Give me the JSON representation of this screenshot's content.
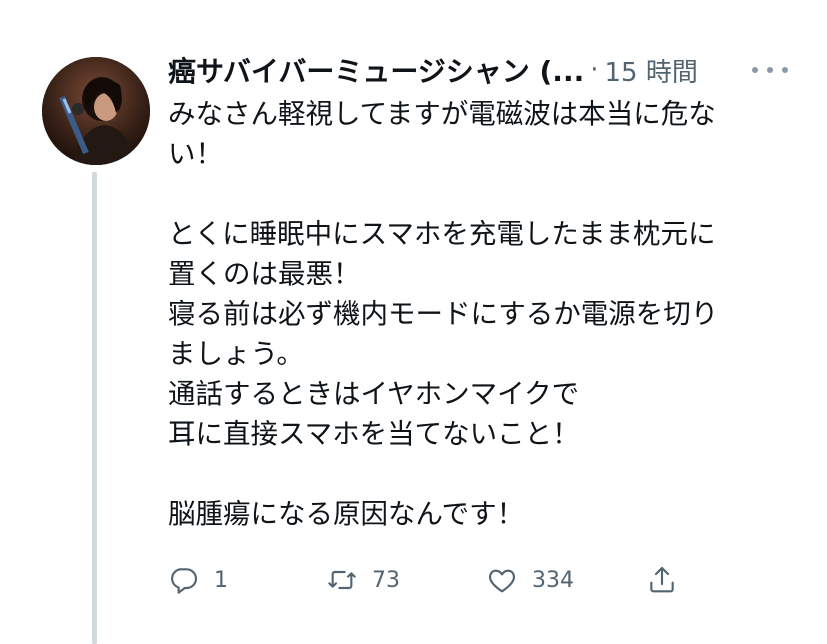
{
  "tweet": {
    "author_name": "癌サバイバーミュージシャン (...",
    "separator": "·",
    "timestamp": "15 時間",
    "avatar_icon": "musician-avatar-icon",
    "more_icon": "more-options-icon",
    "text_lines": [
      "みなさん軽視してますが電磁波は本当に危な",
      "い！",
      "",
      "とくに睡眠中にスマホを充電したまま枕元に",
      "置くのは最悪！",
      "寝る前は必ず機内モードにするか電源を切り",
      "ましょう。",
      "通話するときはイヤホンマイクで",
      "耳に直接スマホを当てないこと！",
      "",
      "脳腫瘍になる原因なんです！"
    ],
    "actions": {
      "reply_count": "1",
      "retweet_count": "73",
      "like_count": "334"
    }
  },
  "colors": {
    "text": "#0f1419",
    "secondary": "#536471",
    "thread_line": "#cfd9de"
  }
}
